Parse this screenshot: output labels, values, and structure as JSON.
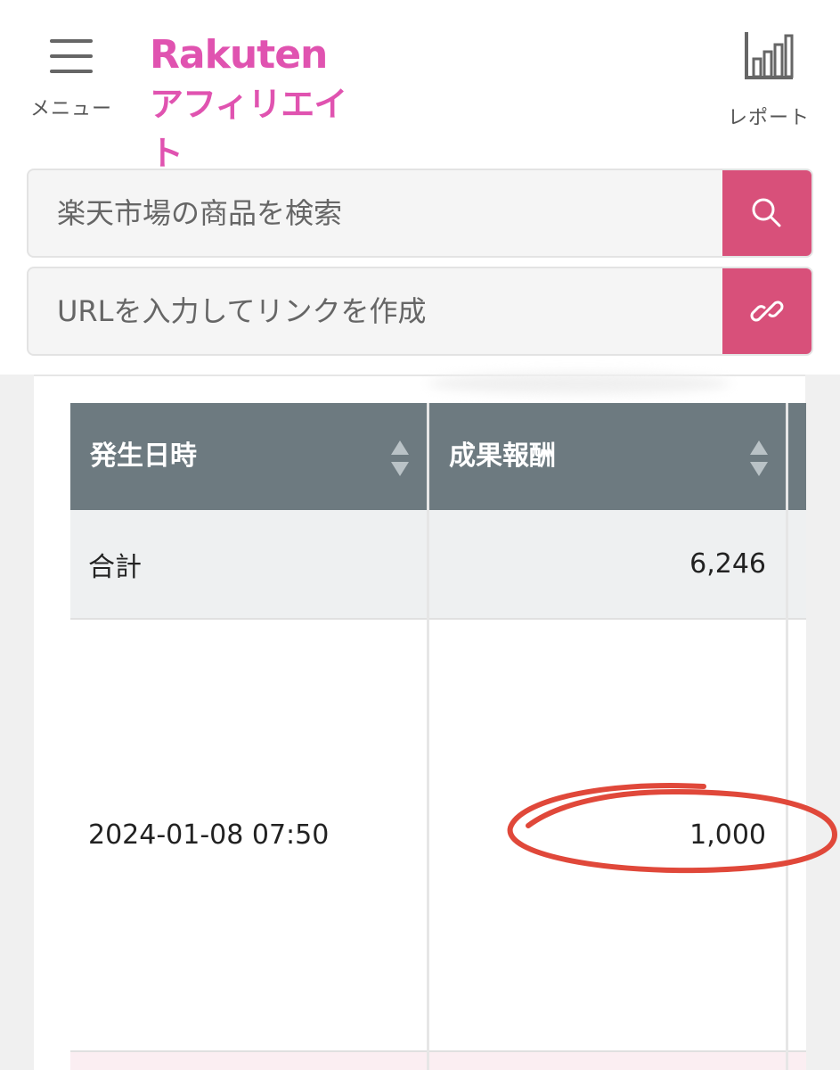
{
  "header": {
    "menu_label": "メニュー",
    "logo_main": "Rakuten",
    "logo_sub": "アフィリエイト",
    "report_label": "レポート"
  },
  "search": {
    "product_placeholder": "楽天市場の商品を検索",
    "url_placeholder": "URLを入力してリンクを作成"
  },
  "table": {
    "columns": [
      "発生日時",
      "成果報酬"
    ],
    "total_row": {
      "label": "合計",
      "amount": "6,246"
    },
    "rows": [
      {
        "datetime": "2024-01-08 07:50",
        "amount": "1,000"
      }
    ]
  },
  "colors": {
    "brand": "#e053b0",
    "button": "#d8507a",
    "table_header": "#6d7a80",
    "highlight": "#e0483a"
  },
  "icons": {
    "menu": "hamburger-icon",
    "report": "bar-chart-icon",
    "search": "search-icon",
    "link": "link-icon",
    "sort": "sort-icon"
  }
}
